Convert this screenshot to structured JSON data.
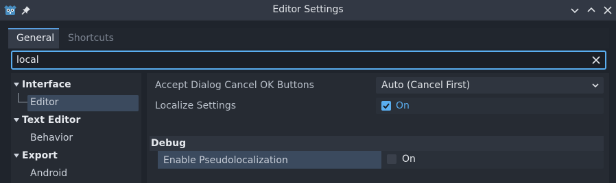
{
  "window": {
    "title": "Editor Settings",
    "colors": {
      "accent": "#5aaef0",
      "selection": "#3b4a5e",
      "background": "#1f242c"
    }
  },
  "tabs": [
    {
      "label": "General",
      "active": true
    },
    {
      "label": "Shortcuts",
      "active": false
    }
  ],
  "search": {
    "value": "local"
  },
  "tree": {
    "sections": [
      {
        "label": "Interface",
        "children": [
          {
            "label": "Editor",
            "selected": true
          }
        ]
      },
      {
        "label": "Text Editor",
        "children": [
          {
            "label": "Behavior",
            "selected": false
          }
        ]
      },
      {
        "label": "Export",
        "children": [
          {
            "label": "Android",
            "selected": false
          }
        ]
      }
    ]
  },
  "properties": {
    "accept_dialog": {
      "label": "Accept Dialog Cancel OK Buttons",
      "value": "Auto (Cancel First)"
    },
    "localize_settings": {
      "label": "Localize Settings",
      "value": "On",
      "checked": true
    },
    "debug_category": {
      "label": "Debug"
    },
    "pseudolocalization": {
      "label": "Enable Pseudolocalization",
      "value": "On",
      "checked": false
    }
  }
}
